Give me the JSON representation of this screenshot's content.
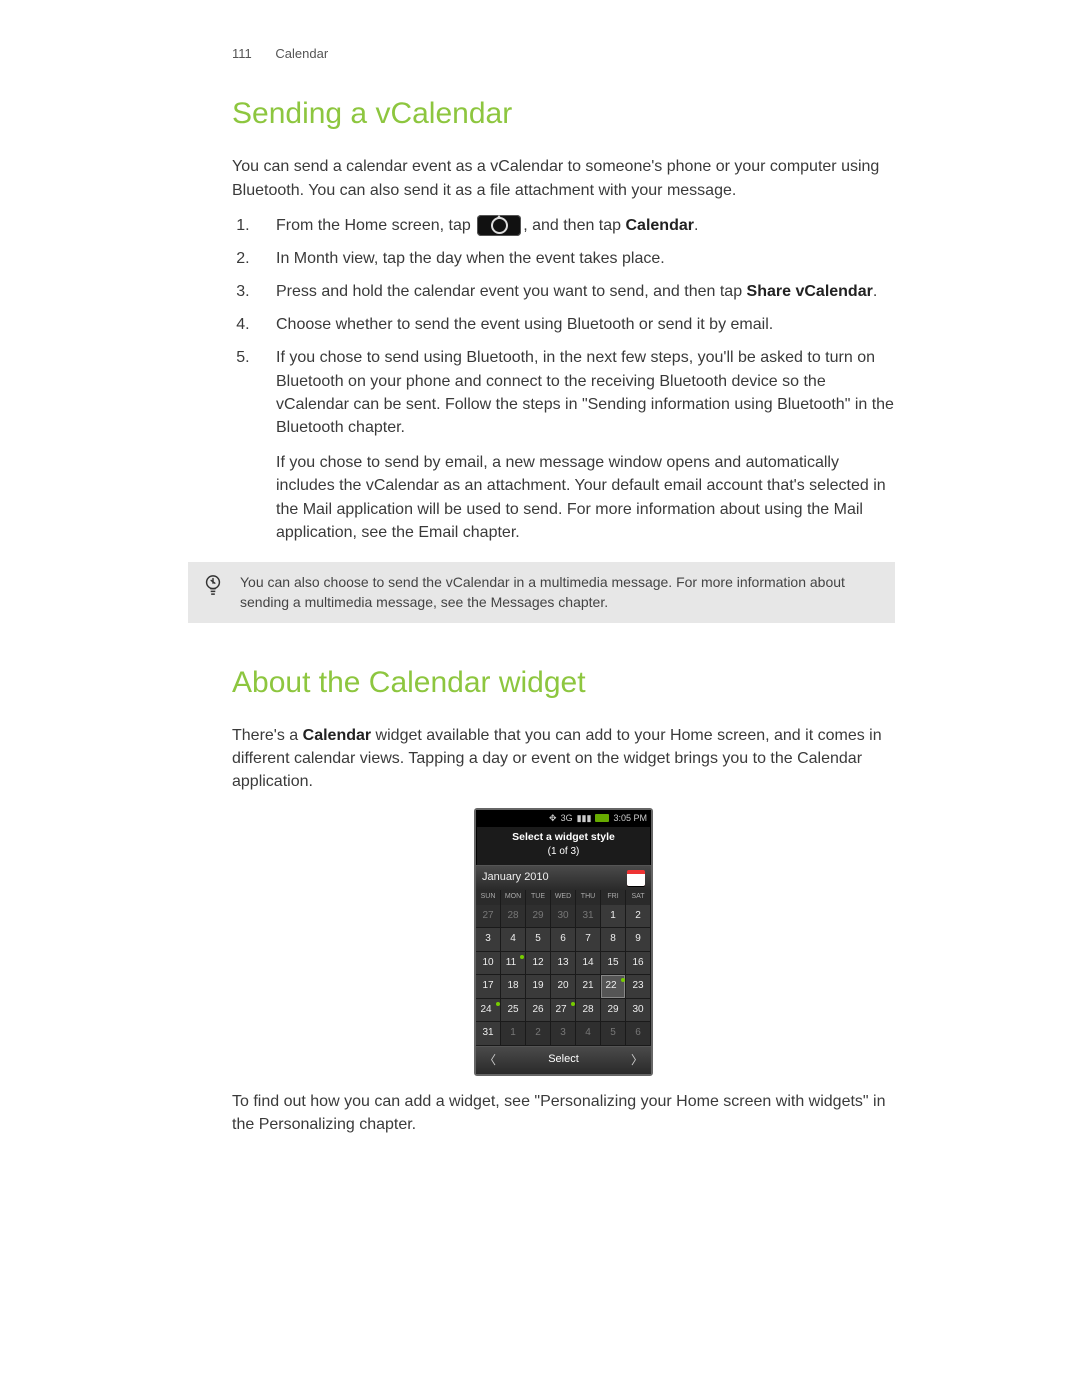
{
  "header": {
    "page_number": "111",
    "chapter": "Calendar"
  },
  "section1": {
    "title": "Sending a vCalendar",
    "intro": "You can send a calendar event as a vCalendar to someone's phone or your computer using Bluetooth. You can also send it as a file attachment with your message.",
    "steps": {
      "s1_pre": "From the Home screen, tap ",
      "s1_post": ", and then tap ",
      "s1_bold": "Calendar",
      "s1_period": ".",
      "s2": "In Month view, tap the day when the event takes place.",
      "s3_pre": "Press and hold the calendar event you want to send, and then tap ",
      "s3_bold": "Share vCalendar",
      "s3_period": ".",
      "s4": "Choose whether to send the event using Bluetooth or send it by email.",
      "s5a": "If you chose to send using Bluetooth, in the next few steps, you'll be asked to turn on Bluetooth on your phone and connect to the receiving Bluetooth device so the vCalendar can be sent. Follow the steps in \"Sending information using Bluetooth\" in the Bluetooth chapter.",
      "s5b": "If you chose to send by email, a new message window opens and automatically includes the vCalendar as an attachment. Your default email account that's selected in the Mail application will be used to send. For more information about using the Mail application, see the Email chapter."
    },
    "tip": "You can also choose to send the vCalendar in a multimedia message. For more information about sending a multimedia message, see the Messages chapter."
  },
  "section2": {
    "title": "About the Calendar widget",
    "p1_pre": "There's a ",
    "p1_bold": "Calendar",
    "p1_post": " widget available that you can add to your Home screen, and it comes in different calendar views. Tapping a day or event on the widget brings you to the Calendar application.",
    "p2": "To find out how you can add a widget, see \"Personalizing your Home screen with widgets\" in the Personalizing chapter."
  },
  "phone": {
    "status": {
      "net": "3G",
      "time": "3:05 PM"
    },
    "title": "Select a widget style",
    "subtitle": "(1 of 3)",
    "month": "January 2010",
    "dow": [
      "SUN",
      "MON",
      "TUE",
      "WED",
      "THU",
      "FRI",
      "SAT"
    ],
    "cells": [
      {
        "v": "27",
        "dim": true
      },
      {
        "v": "28",
        "dim": true
      },
      {
        "v": "29",
        "dim": true
      },
      {
        "v": "30",
        "dim": true
      },
      {
        "v": "31",
        "dim": true
      },
      {
        "v": "1"
      },
      {
        "v": "2"
      },
      {
        "v": "3"
      },
      {
        "v": "4"
      },
      {
        "v": "5"
      },
      {
        "v": "6"
      },
      {
        "v": "7"
      },
      {
        "v": "8"
      },
      {
        "v": "9"
      },
      {
        "v": "10"
      },
      {
        "v": "11",
        "mark": true
      },
      {
        "v": "12"
      },
      {
        "v": "13"
      },
      {
        "v": "14"
      },
      {
        "v": "15"
      },
      {
        "v": "16"
      },
      {
        "v": "17"
      },
      {
        "v": "18"
      },
      {
        "v": "19"
      },
      {
        "v": "20"
      },
      {
        "v": "21"
      },
      {
        "v": "22",
        "hl": true,
        "mark": true
      },
      {
        "v": "23"
      },
      {
        "v": "24",
        "mark": true
      },
      {
        "v": "25"
      },
      {
        "v": "26"
      },
      {
        "v": "27",
        "mark": true
      },
      {
        "v": "28"
      },
      {
        "v": "29"
      },
      {
        "v": "30"
      },
      {
        "v": "31"
      },
      {
        "v": "1",
        "dim": true
      },
      {
        "v": "2",
        "dim": true
      },
      {
        "v": "3",
        "dim": true
      },
      {
        "v": "4",
        "dim": true
      },
      {
        "v": "5",
        "dim": true
      },
      {
        "v": "6",
        "dim": true
      }
    ],
    "select": "Select"
  }
}
